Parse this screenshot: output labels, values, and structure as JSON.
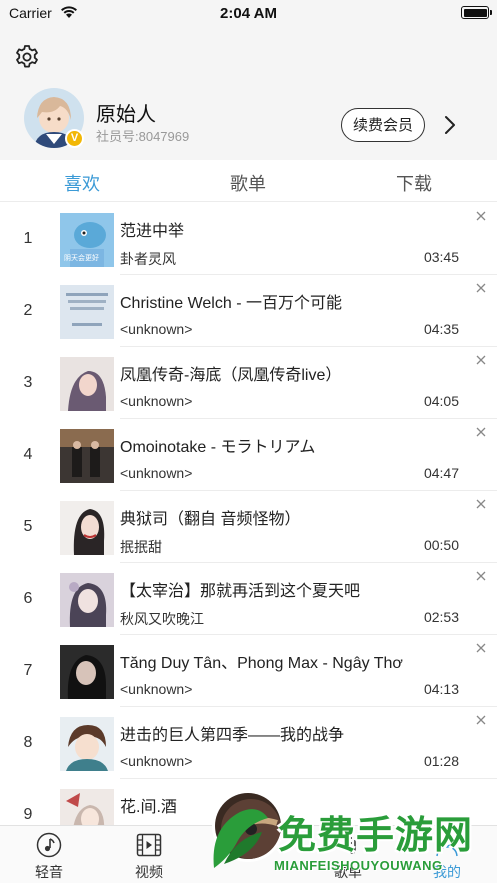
{
  "status_bar": {
    "carrier": "Carrier",
    "time": "2:04 AM"
  },
  "profile": {
    "name": "原始人",
    "member_id": "社员号:8047969",
    "badge": "V",
    "renew_label": "续费会员"
  },
  "tabs": [
    {
      "label": "喜欢",
      "active": true
    },
    {
      "label": "歌单",
      "active": false
    },
    {
      "label": "下载",
      "active": false
    }
  ],
  "songs": [
    {
      "index": "1",
      "title": "范进中举",
      "artist": "卦者灵风",
      "duration": "03:45",
      "cover_caption": "阴天会更好"
    },
    {
      "index": "2",
      "title": "Christine Welch - 一百万个可能",
      "artist": "<unknown>",
      "duration": "04:35"
    },
    {
      "index": "3",
      "title": "凤凰传奇-海底（凤凰传奇live）",
      "artist": "<unknown>",
      "duration": "04:05"
    },
    {
      "index": "4",
      "title": "Omoinotake - モラトリアム",
      "artist": "<unknown>",
      "duration": "04:47"
    },
    {
      "index": "5",
      "title": "典狱司（翻自 音频怪物）",
      "artist": "抿抿甜",
      "duration": "00:50"
    },
    {
      "index": "6",
      "title": "【太宰治】那就再活到这个夏天吧",
      "artist": "秋风又吹晚江",
      "duration": "02:53"
    },
    {
      "index": "7",
      "title": "Tăng Duy Tân、Phong Max - Ngây Thơ",
      "artist": "<unknown>",
      "duration": "04:13"
    },
    {
      "index": "8",
      "title": "进击的巨人第四季——我的战争",
      "artist": "<unknown>",
      "duration": "01:28"
    },
    {
      "index": "9",
      "title": "花.间.酒",
      "artist": "",
      "duration": ""
    }
  ],
  "tab_bar": [
    {
      "label": "轻音",
      "icon": "music-note-icon"
    },
    {
      "label": "视频",
      "icon": "film-icon"
    },
    {
      "label": "歌单",
      "icon": "playlist-icon"
    },
    {
      "label": "我的",
      "icon": "profile-icon"
    }
  ],
  "watermark": {
    "title": "免费手游网",
    "subtitle": "MIANFEISHOUYOUWANG"
  },
  "colors": {
    "accent": "#3b9ad6",
    "badge": "#f2b705",
    "watermark": "#2a9d3a"
  }
}
